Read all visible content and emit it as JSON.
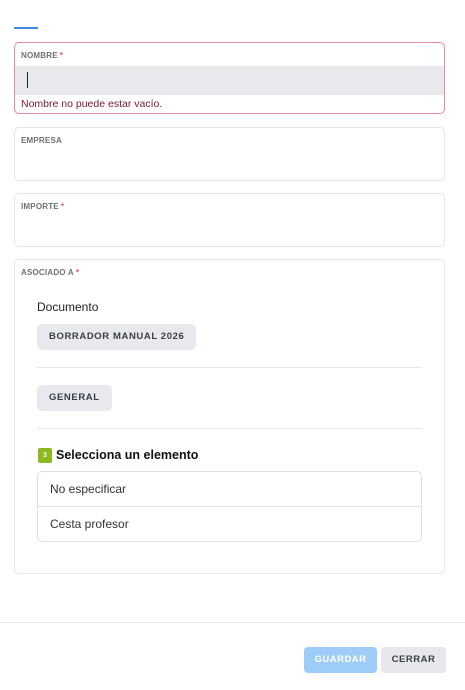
{
  "form": {
    "nombre": {
      "label": "NOMBRE",
      "required_mark": "*",
      "value": "",
      "error": "Nombre no puede estar vacío."
    },
    "empresa": {
      "label": "EMPRESA",
      "value": ""
    },
    "importe": {
      "label": "IMPORTE",
      "required_mark": "*",
      "value": ""
    },
    "asociado": {
      "label": "ASOCIADO A",
      "required_mark": "*",
      "document_label": "Documento",
      "document_chip": "BORRADOR MANUAL 2026",
      "category_chip": "GENERAL",
      "step": {
        "number": "3",
        "title": "Selecciona un elemento"
      },
      "options": [
        "No especificar",
        "Cesta profesor"
      ]
    }
  },
  "footer": {
    "save_label": "GUARDAR",
    "close_label": "CERRAR"
  },
  "colors": {
    "accent": "#3b8de0",
    "error_border": "#e58aa3",
    "required": "#e0556e",
    "step_badge": "#8cb820",
    "save_button": "#9dcdf6"
  }
}
